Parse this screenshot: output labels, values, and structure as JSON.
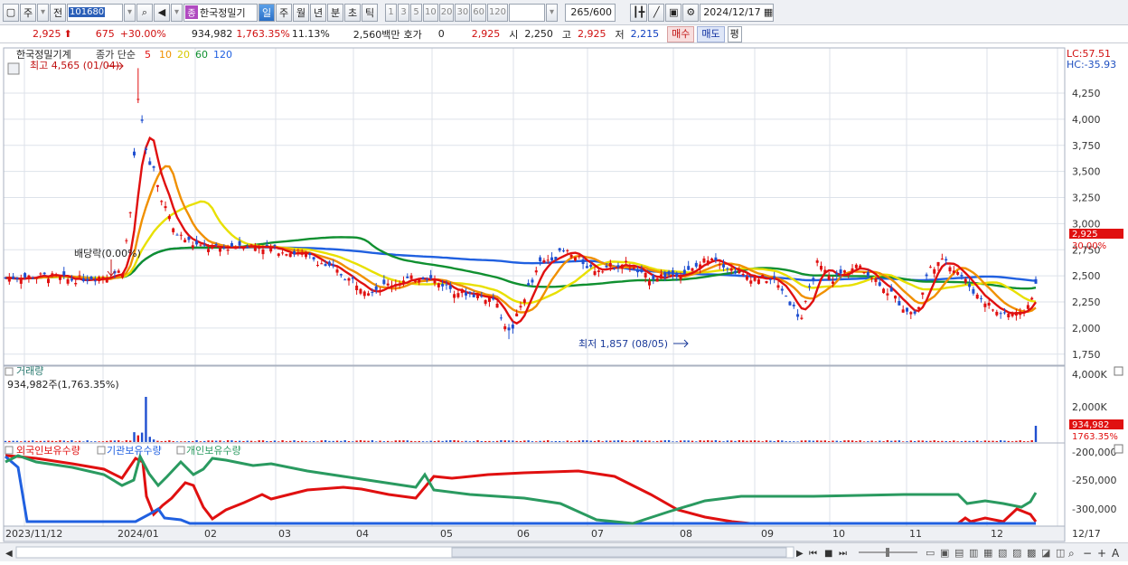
{
  "toolbar": {
    "period_type": "주",
    "prev_label": "전",
    "stock_code": "101680",
    "stock_badge": "종",
    "stock_name": "한국정밀기",
    "periods": [
      "일",
      "주",
      "월",
      "년",
      "분",
      "초",
      "틱"
    ],
    "selected_period": "일",
    "multipliers": [
      "1",
      "3",
      "5",
      "10",
      "20",
      "30",
      "60",
      "120"
    ],
    "count": "265",
    "count_total": "/600",
    "date": "2024/12/17"
  },
  "quote": {
    "price": "2,925",
    "change": "675",
    "change_rate": "+30.00%",
    "volume": "934,982",
    "volume_rate": "1,763.35%",
    "turnover_rate": "11.13%",
    "amount": "2,560백만",
    "hoga_label": "호가",
    "hoga_value": "0",
    "hoga_price": "2,925",
    "open_label": "시",
    "open": "2,250",
    "high_label": "고",
    "high": "2,925",
    "low_label": "저",
    "low": "2,215",
    "buy_label": "매수",
    "sell_label": "매도",
    "avg_label": "평"
  },
  "price_panel": {
    "name": "한국정밀기계",
    "legend_label": "종가 단순",
    "ma": [
      {
        "label": "5",
        "color": "#e01010"
      },
      {
        "label": "10",
        "color": "#f09000"
      },
      {
        "label": "20",
        "color": "#e8e000"
      },
      {
        "label": "60",
        "color": "#109030"
      },
      {
        "label": "120",
        "color": "#2060e0"
      }
    ],
    "lc_label": "LC:57.51",
    "hc_label": "HC:-35.93",
    "high_annot": "최고 4,565 (01/04)",
    "low_annot": "최저 1,857 (08/05)",
    "dividend_annot": "배당락(0.00%)",
    "current_price_tag": "2,925",
    "current_rate_tag": "30.00%",
    "y_ticks": [
      "4,250",
      "4,000",
      "3,750",
      "3,500",
      "3,250",
      "3,000",
      "2,750",
      "2,500",
      "2,250",
      "2,000",
      "1,750"
    ]
  },
  "volume_panel": {
    "title": "거래량",
    "value": "934,982주(1,763.35%)",
    "y_ticks": [
      "4,000K",
      "2,000K"
    ],
    "current_tag": "934,982",
    "current_rate": "1763.35%"
  },
  "holdings_panel": {
    "series": [
      {
        "name": "외국인보유수량",
        "color": "#e01010"
      },
      {
        "name": "기관보유수량",
        "color": "#2060e0"
      },
      {
        "name": "개인보유수량",
        "color": "#2a9a60"
      }
    ],
    "y_ticks": [
      "-200,000",
      "-250,000",
      "-300,000"
    ]
  },
  "x_axis": {
    "labels": [
      "2023/11/12",
      "2024/01",
      "02",
      "03",
      "04",
      "05",
      "06",
      "07",
      "08",
      "09",
      "10",
      "11",
      "12"
    ],
    "right_label": "12/17"
  },
  "colors": {
    "up": "#e01010",
    "down": "#2050d0",
    "grid": "#dde2ea"
  }
}
